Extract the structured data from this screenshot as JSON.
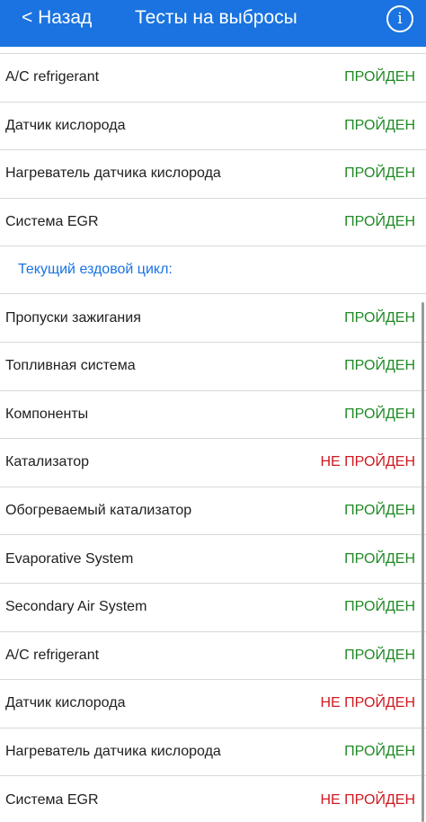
{
  "header": {
    "back_label": "< Назад",
    "title": "Тесты на выбросы",
    "info_label": "i",
    "bg_color": "#1a73e0"
  },
  "colors": {
    "pass": "#1f8a24",
    "fail": "#d0191f",
    "section": "#1a73e0"
  },
  "previous_tests": [
    {
      "name": "A/C refrigerant",
      "status": "ПРОЙДЕН",
      "result": "pass"
    },
    {
      "name": "Датчик кислорода",
      "status": "ПРОЙДЕН",
      "result": "pass"
    },
    {
      "name": "Нагреватель датчика кислорода",
      "status": "ПРОЙДЕН",
      "result": "pass"
    },
    {
      "name": "Система EGR",
      "status": "ПРОЙДЕН",
      "result": "pass"
    }
  ],
  "current_cycle": {
    "title": "Текущий ездовой цикл:",
    "items": [
      {
        "name": "Пропуски зажигания",
        "status": "ПРОЙДЕН",
        "result": "pass"
      },
      {
        "name": "Топливная система",
        "status": "ПРОЙДЕН",
        "result": "pass"
      },
      {
        "name": "Компоненты",
        "status": "ПРОЙДЕН",
        "result": "pass"
      },
      {
        "name": "Катализатор",
        "status": "НЕ ПРОЙДЕН",
        "result": "fail"
      },
      {
        "name": "Обогреваемый катализатор",
        "status": "ПРОЙДЕН",
        "result": "pass"
      },
      {
        "name": "Evaporative System",
        "status": "ПРОЙДЕН",
        "result": "pass"
      },
      {
        "name": "Secondary Air System",
        "status": "ПРОЙДЕН",
        "result": "pass"
      },
      {
        "name": "A/C refrigerant",
        "status": "ПРОЙДЕН",
        "result": "pass"
      },
      {
        "name": "Датчик кислорода",
        "status": "НЕ ПРОЙДЕН",
        "result": "fail"
      },
      {
        "name": "Нагреватель датчика кислорода",
        "status": "ПРОЙДЕН",
        "result": "pass"
      },
      {
        "name": "Система EGR",
        "status": "НЕ ПРОЙДЕН",
        "result": "fail"
      }
    ]
  }
}
